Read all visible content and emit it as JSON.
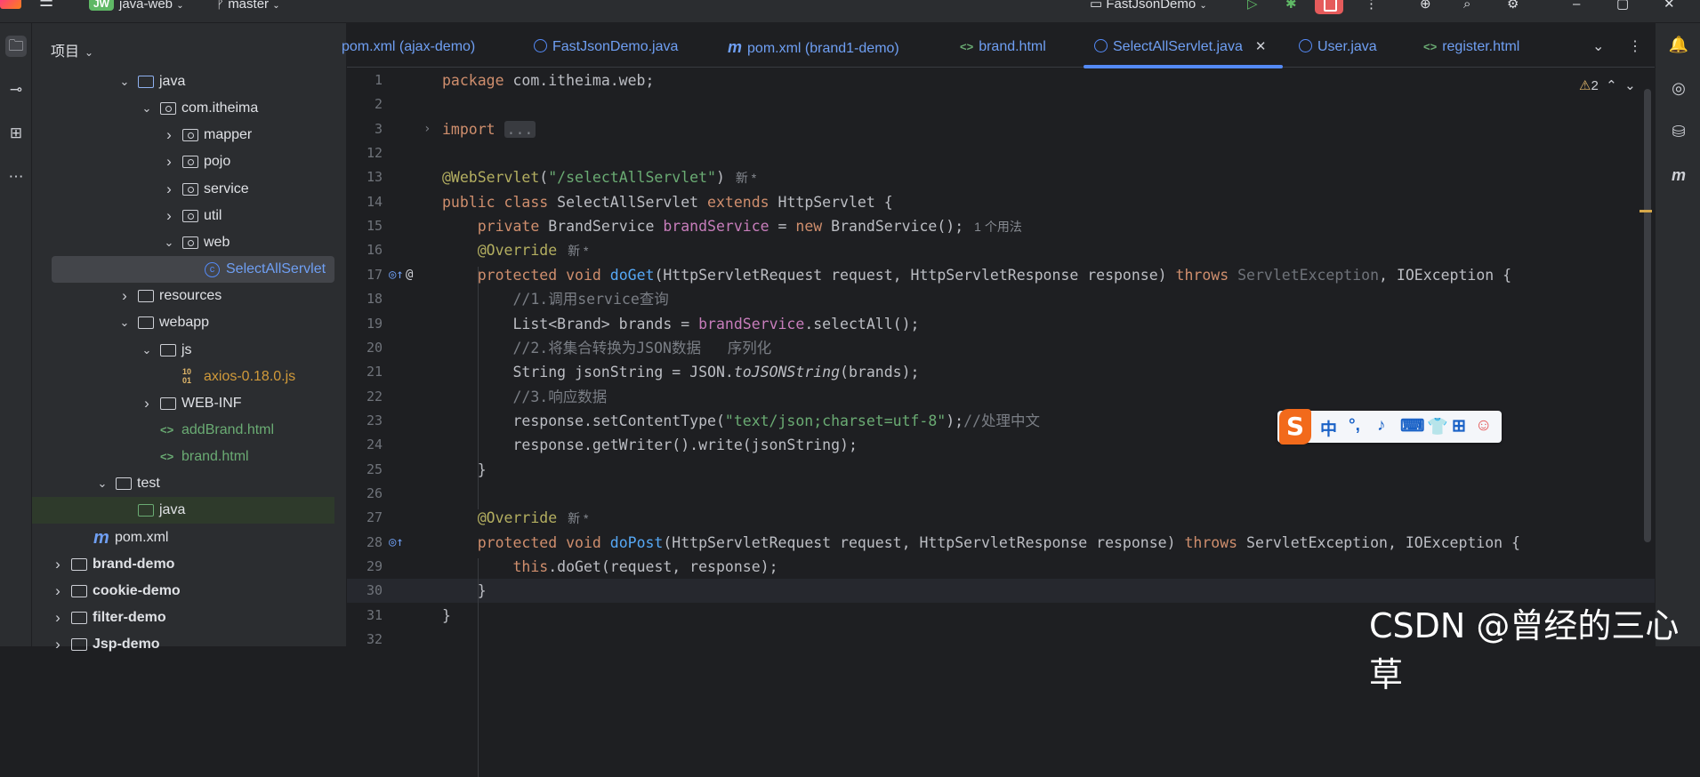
{
  "topbar": {
    "project_badge": "JW",
    "project_name": "java-web",
    "branch": "master",
    "run_config": "FastJsonDemo"
  },
  "project_panel": {
    "title": "项目",
    "tree": [
      {
        "label": "java",
        "kind": "folder-src",
        "depth": 3,
        "expanded": true
      },
      {
        "label": "com.itheima",
        "kind": "package",
        "depth": 4,
        "expanded": true
      },
      {
        "label": "mapper",
        "kind": "package",
        "depth": 5,
        "expanded": false
      },
      {
        "label": "pojo",
        "kind": "package",
        "depth": 5,
        "expanded": false
      },
      {
        "label": "service",
        "kind": "package",
        "depth": 5,
        "expanded": false
      },
      {
        "label": "util",
        "kind": "package",
        "depth": 5,
        "expanded": false
      },
      {
        "label": "web",
        "kind": "package",
        "depth": 5,
        "expanded": true
      },
      {
        "label": "SelectAllServlet",
        "kind": "class",
        "depth": 6,
        "selected": true
      },
      {
        "label": "resources",
        "kind": "folder",
        "depth": 3,
        "expanded": false
      },
      {
        "label": "webapp",
        "kind": "folder",
        "depth": 3,
        "expanded": true
      },
      {
        "label": "js",
        "kind": "folder",
        "depth": 4,
        "expanded": true
      },
      {
        "label": "axios-0.18.0.js",
        "kind": "jsfile",
        "depth": 5
      },
      {
        "label": "WEB-INF",
        "kind": "folder",
        "depth": 4,
        "expanded": false
      },
      {
        "label": "addBrand.html",
        "kind": "html",
        "depth": 4
      },
      {
        "label": "brand.html",
        "kind": "html",
        "depth": 4
      },
      {
        "label": "test",
        "kind": "folder",
        "depth": 2,
        "expanded": true
      },
      {
        "label": "java",
        "kind": "folder-test",
        "depth": 3
      },
      {
        "label": "pom.xml",
        "kind": "maven",
        "depth": 1
      },
      {
        "label": "brand-demo",
        "kind": "module",
        "depth": 0,
        "expanded": false
      },
      {
        "label": "cookie-demo",
        "kind": "module",
        "depth": 0,
        "expanded": false
      },
      {
        "label": "filter-demo",
        "kind": "module",
        "depth": 0,
        "expanded": false
      },
      {
        "label": "Jsp-demo",
        "kind": "module",
        "depth": 0,
        "expanded": false
      }
    ]
  },
  "tabs": [
    {
      "label": "pom.xml (ajax-demo)",
      "icon": "none"
    },
    {
      "label": "FastJsonDemo.java",
      "icon": "class"
    },
    {
      "label": "pom.xml (brand1-demo)",
      "icon": "maven"
    },
    {
      "label": "brand.html",
      "icon": "html"
    },
    {
      "label": "SelectAllServlet.java",
      "icon": "class",
      "active": true
    },
    {
      "label": "User.java",
      "icon": "class"
    },
    {
      "label": "register.html",
      "icon": "html"
    }
  ],
  "inspections": {
    "warnings": "2"
  },
  "code": {
    "lines": [
      {
        "n": "1",
        "html": "<span class=\"kw\">package</span> com.itheima.web;"
      },
      {
        "n": "2",
        "html": ""
      },
      {
        "n": "3",
        "html": "<span class=\"kw\">import</span> <span class=\"fold-box\">...</span>"
      },
      {
        "n": "12",
        "html": ""
      },
      {
        "n": "13",
        "html": "<span class=\"an\">@WebServlet</span>(<span class=\"str\">\"/selectAllServlet\"</span>)<span class=\"hint\">新 *</span>"
      },
      {
        "n": "14",
        "html": "<span class=\"kw\">public class</span> SelectAllServlet <span class=\"kw\">extends</span> HttpServlet {"
      },
      {
        "n": "15",
        "html": "    <span class=\"kw\">private</span> BrandService <span class=\"fld\">brandService</span> = <span class=\"kw\">new</span> BrandService();<span class=\"hint\">1 个用法</span>"
      },
      {
        "n": "16",
        "html": "    <span class=\"an\">@Override</span><span class=\"hint\">新 *</span>"
      },
      {
        "n": "17",
        "html": "    <span class=\"kw\">protected void</span> <span class=\"fn\">doGet</span>(HttpServletRequest request, HttpServletResponse response) <span class=\"kw\">throws</span> <span class=\"muted\">ServletException</span>, IOException {"
      },
      {
        "n": "18",
        "html": "        <span class=\"cm\">//1.调用service查询</span>"
      },
      {
        "n": "19",
        "html": "        List&lt;Brand&gt; brands = <span class=\"fld\">brandService</span>.selectAll();"
      },
      {
        "n": "20",
        "html": "        <span class=\"cm\">//2.将集合转换为JSON数据   序列化</span>"
      },
      {
        "n": "21",
        "html": "        String jsonString = JSON.<span class=\"ital\">toJSONString</span>(brands);"
      },
      {
        "n": "22",
        "html": "        <span class=\"cm\">//3.响应数据</span>"
      },
      {
        "n": "23",
        "html": "        response.setContentType(<span class=\"str\">\"text/json;charset=utf-8\"</span>);<span class=\"cm\">//处理中文</span>"
      },
      {
        "n": "24",
        "html": "        response.getWriter().write(jsonString);"
      },
      {
        "n": "25",
        "html": "    }"
      },
      {
        "n": "26",
        "html": ""
      },
      {
        "n": "27",
        "html": "    <span class=\"an\">@Override</span><span class=\"hint\">新 *</span>"
      },
      {
        "n": "28",
        "html": "    <span class=\"kw\">protected void</span> <span class=\"fn\">doPost</span>(HttpServletRequest request, HttpServletResponse response) <span class=\"kw\">throws</span> ServletException, IOException {"
      },
      {
        "n": "29",
        "html": "        <span class=\"kw\">this</span>.doGet(request, response);"
      },
      {
        "n": "30",
        "html": "    }",
        "current": true
      },
      {
        "n": "31",
        "html": "}"
      },
      {
        "n": "32",
        "html": ""
      }
    ]
  },
  "ime": {
    "logo": "S",
    "lang": "中"
  },
  "watermark": "CSDN @曾经的三心草"
}
